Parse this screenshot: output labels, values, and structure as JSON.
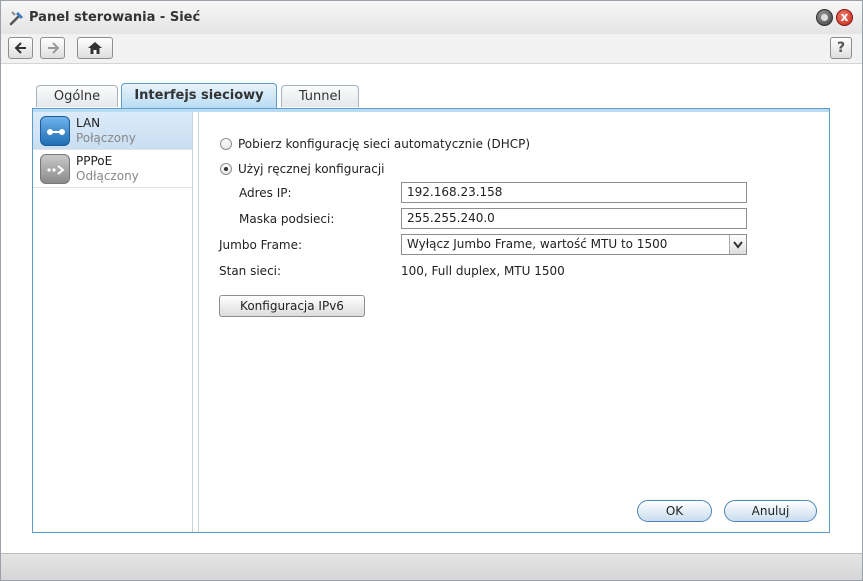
{
  "window": {
    "title": "Panel sterowania - Sieć",
    "close_glyph": "x",
    "help_glyph": "?"
  },
  "toolbar": {
    "back_icon": "arrow-left-icon",
    "forward_icon": "arrow-right-icon",
    "home_icon": "home-icon"
  },
  "tabs": [
    {
      "label": "Ogólne",
      "active": false
    },
    {
      "label": "Interfejs sieciowy",
      "active": true
    },
    {
      "label": "Tunnel",
      "active": false
    }
  ],
  "interfaces": [
    {
      "name": "LAN",
      "status": "Połączony",
      "selected": true,
      "icon": "lan-icon"
    },
    {
      "name": "PPPoE",
      "status": "Odłączony",
      "selected": false,
      "icon": "pppoe-icon"
    }
  ],
  "config": {
    "dhcp_label": "Pobierz konfigurację sieci automatycznie (DHCP)",
    "manual_label": "Użyj ręcznej konfiguracji",
    "selected_mode": "manual",
    "ip_label": "Adres IP:",
    "ip_value": "192.168.23.158",
    "mask_label": "Maska podsieci:",
    "mask_value": "255.255.240.0",
    "jumbo_label": "Jumbo Frame:",
    "jumbo_value": "Wyłącz Jumbo Frame, wartość MTU to 1500",
    "state_label": "Stan sieci:",
    "state_value": "100, Full duplex, MTU 1500",
    "ipv6_button": "Konfiguracja IPv6"
  },
  "footer": {
    "ok_label": "OK",
    "cancel_label": "Anuluj"
  },
  "colors": {
    "accent": "#5e9ccd",
    "selected_bg": "#c9def2",
    "close_red": "#c0281a"
  }
}
